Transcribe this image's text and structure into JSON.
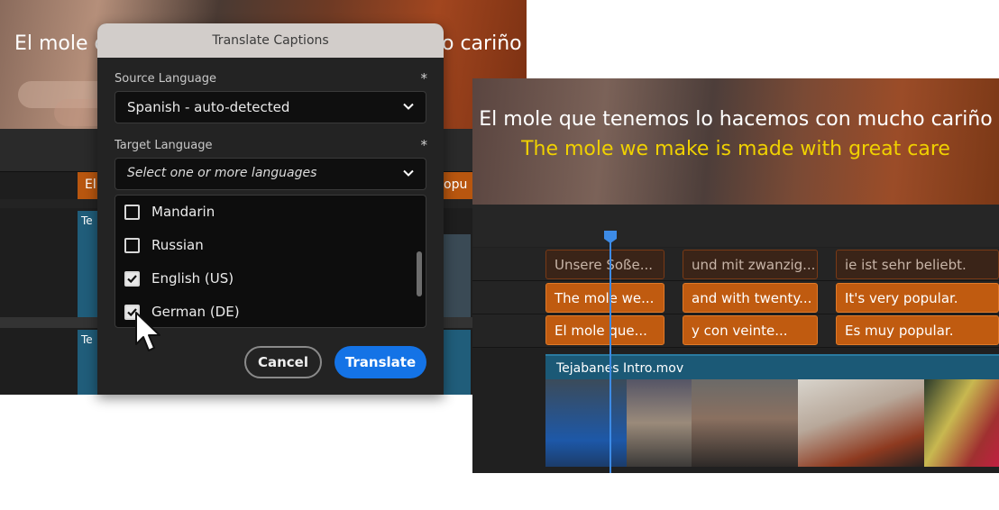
{
  "background_editor": {
    "caption_left": "El mole q",
    "caption_right": "o cariño",
    "clip_chip_left": "El",
    "clip_chip_right": "opu",
    "clip_label_1": "Te",
    "clip_label_2": "Te"
  },
  "dialog": {
    "title": "Translate Captions",
    "source_language": {
      "label": "Source Language",
      "required_mark": "*",
      "value": "Spanish - auto-detected"
    },
    "target_language": {
      "label": "Target Language",
      "required_mark": "*",
      "placeholder": "Select one or more languages"
    },
    "languages": [
      {
        "label": "Mandarin",
        "checked": false
      },
      {
        "label": "Russian",
        "checked": false
      },
      {
        "label": "English (US)",
        "checked": true
      },
      {
        "label": "German (DE)",
        "checked": true
      }
    ],
    "buttons": {
      "cancel": "Cancel",
      "translate": "Translate"
    }
  },
  "timeline": {
    "preview_caption_original": "El mole que tenemos lo hacemos con mucho cariño",
    "preview_caption_translated": "The mole we make is made with great care",
    "caption_tracks": [
      [
        "Unsere Soße...",
        "und mit zwanzig...",
        "ie ist sehr beliebt."
      ],
      [
        "The mole we...",
        "and with twenty...",
        "It's very popular."
      ],
      [
        "El mole que...",
        "y con veinte...",
        "Es muy popular."
      ]
    ],
    "clip_name": "Tejabanes Intro.mov"
  },
  "colors": {
    "accent_blue": "#1473e6",
    "caption_orange": "#c05b10",
    "translated_caption_yellow": "#f0d100",
    "clip_teal": "#1b5976"
  }
}
